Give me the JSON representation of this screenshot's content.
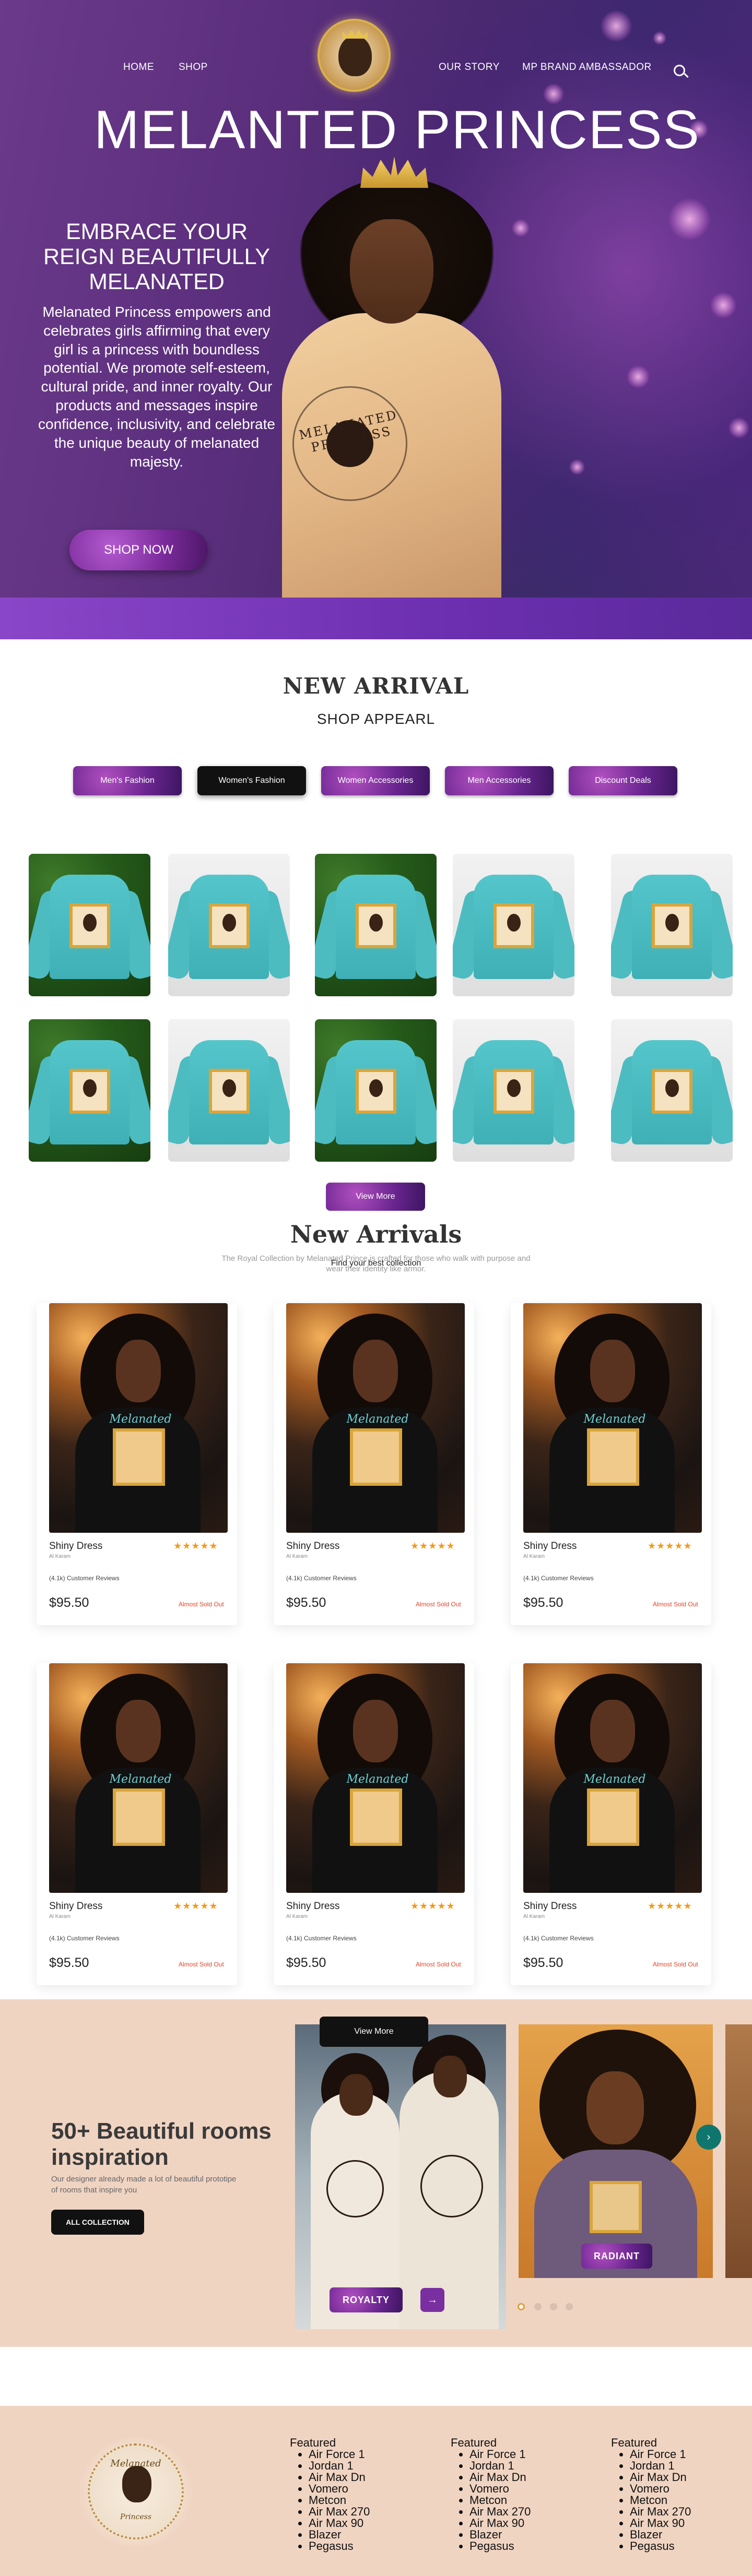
{
  "nav": {
    "home": "HOME",
    "shop": "SHOP",
    "our_story": "OUR STORY",
    "ambassador": "MP BRAND AMBASSADOR"
  },
  "hero": {
    "title": "MELANTED PRINCESS",
    "subtitle": "EMBRACE YOUR REIGN BEAUTIFULLY MELANATED",
    "description": "Melanated Princess empowers and celebrates girls affirming that every girl is a princess with boundless potential. We promote self-esteem, cultural pride, and inner royalty. Our products and messages inspire confidence, inclusivity, and celebrate the unique beauty of melanated majesty.",
    "hoodie_text": "MELANATED PRINCESS",
    "cta": "SHOP NOW"
  },
  "new_arrival": {
    "title": "NEW ARRIVAL",
    "subtitle": "SHOP APPEARL",
    "categories": [
      "Men's Fashion",
      "Women's Fashion",
      "Women Accessories",
      "Men Accessories",
      "Discount Deals"
    ],
    "active_category": "Women's Fashion",
    "view_more": "View More"
  },
  "new_arrivals": {
    "title": "New Arrivals",
    "description": "The Royal Collection by Melanated Prince is crafted for those who walk with purpose and wear their identity like armor.",
    "find_text": "Find your best collection",
    "product_print_text": "Melanated",
    "products": [
      {
        "name": "Shiny Dress",
        "brand": "Al Karam",
        "stars": "★★★★★",
        "reviews": "(4.1k) Customer Reviews",
        "price": "$95.50",
        "status": "Almost Sold Out"
      },
      {
        "name": "Shiny Dress",
        "brand": "Al Karam",
        "stars": "★★★★★",
        "reviews": "(4.1k) Customer Reviews",
        "price": "$95.50",
        "status": "Almost Sold Out"
      },
      {
        "name": "Shiny Dress",
        "brand": "Al Karam",
        "stars": "★★★★★",
        "reviews": "(4.1k) Customer Reviews",
        "price": "$95.50",
        "status": "Almost Sold Out"
      },
      {
        "name": "Shiny Dress",
        "brand": "Al Karam",
        "stars": "★★★★★",
        "reviews": "(4.1k) Customer Reviews",
        "price": "$95.50",
        "status": "Almost Sold Out"
      },
      {
        "name": "Shiny Dress",
        "brand": "Al Karam",
        "stars": "★★★★★",
        "reviews": "(4.1k) Customer Reviews",
        "price": "$95.50",
        "status": "Almost Sold Out"
      },
      {
        "name": "Shiny Dress",
        "brand": "Al Karam",
        "stars": "★★★★★",
        "reviews": "(4.1k) Customer Reviews",
        "price": "$95.50",
        "status": "Almost Sold Out"
      }
    ]
  },
  "inspiration": {
    "title": "50+ Beautiful rooms inspiration",
    "description": "Our designer already made a lot of beautiful prototipe of rooms that inspire you",
    "button": "ALL COLLECTION",
    "view_more": "View More",
    "slide1_label": "ROYALTY",
    "slide2_label": "RADIANT",
    "arrow_label": "→",
    "next_label": "›"
  },
  "footer": {
    "logo_text_top": "Melanated",
    "logo_text_bottom": "Princess",
    "columns": [
      {
        "heading": "Featured",
        "items": [
          "Air Force 1",
          "Jordan 1",
          "Air Max Dn",
          "Vomero",
          "Metcon",
          "Air Max 270",
          "Air Max 90",
          "Blazer",
          "Pegasus"
        ]
      },
      {
        "heading": "Featured",
        "items": [
          "Air Force 1",
          "Jordan 1",
          "Air Max Dn",
          "Vomero",
          "Metcon",
          "Air Max 270",
          "Air Max 90",
          "Blazer",
          "Pegasus"
        ]
      },
      {
        "heading": "Featured",
        "items": [
          "Air Force 1",
          "Jordan 1",
          "Air Max Dn",
          "Vomero",
          "Metcon",
          "Air Max 270",
          "Air Max 90",
          "Blazer",
          "Pegasus"
        ]
      }
    ]
  },
  "colors": {
    "accent_purple": "#6a2590",
    "peach_bg": "#f0d4c2",
    "sold_out_red": "#e0452a",
    "star_orange": "#f39a1a"
  }
}
